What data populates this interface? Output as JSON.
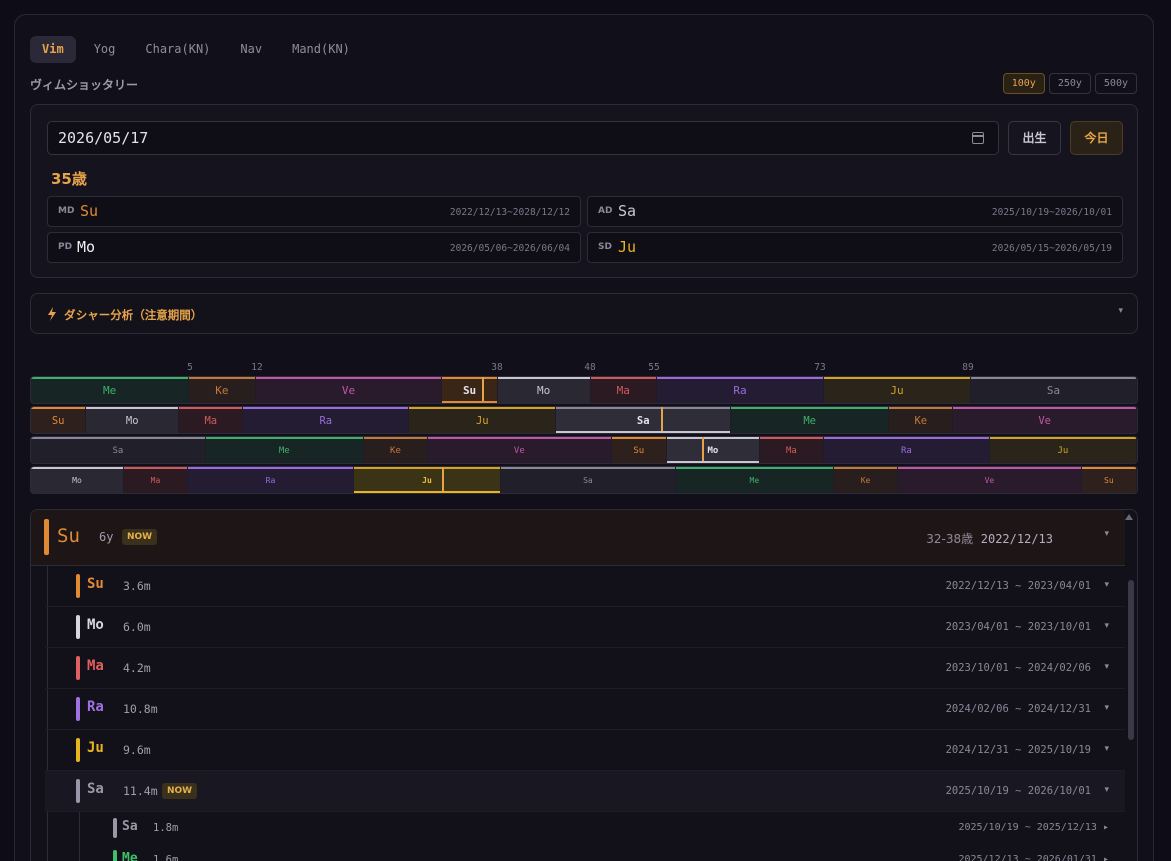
{
  "tabs": [
    "Vim",
    "Yog",
    "Chara(KN)",
    "Nav",
    "Mand(KN)"
  ],
  "subtitle": "ヴィムショッタリー",
  "ranges": [
    "100y",
    "250y",
    "500y"
  ],
  "date_value": "2026/05/17",
  "btn_birth": "出生",
  "btn_today": "今日",
  "age": "35歳",
  "current_dasas": [
    {
      "label": "MD",
      "planet": "Su",
      "range": "2022/12/13~2028/12/12",
      "color": "#e08a34"
    },
    {
      "label": "AD",
      "planet": "Sa",
      "range": "2025/10/19~2026/10/01",
      "color": "#c9c7d3"
    },
    {
      "label": "PD",
      "planet": "Mo",
      "range": "2026/05/06~2026/06/04",
      "color": "#f2f1f6"
    },
    {
      "label": "SD",
      "planet": "Ju",
      "range": "2026/05/15~2026/05/19",
      "color": "#e8b420"
    }
  ],
  "dashar_title": "ダシャー分析（注意期間）",
  "timeline_ticks": [
    "5",
    "12",
    "38",
    "48",
    "55",
    "73",
    "89"
  ],
  "timeline_rows": [
    [
      [
        "Me",
        14.3
      ],
      [
        "Ke",
        6.0
      ],
      [
        "Ve",
        16.9
      ],
      [
        "Su",
        5.0
      ],
      [
        "Mo",
        8.4
      ],
      [
        "Ma",
        6.0
      ],
      [
        "Ra",
        15.1
      ],
      [
        "Ju",
        13.3
      ],
      [
        "Sa",
        15.0
      ]
    ],
    [
      [
        "Su",
        5.0
      ],
      [
        "Mo",
        8.4
      ],
      [
        "Ma",
        5.8
      ],
      [
        "Ra",
        15.0
      ],
      [
        "Ju",
        13.3
      ],
      [
        "Sa",
        15.8
      ],
      [
        "Me",
        14.3
      ],
      [
        "Ke",
        5.8
      ],
      [
        "Ve",
        16.6
      ]
    ],
    [
      [
        "Sa",
        15.8
      ],
      [
        "Me",
        14.3
      ],
      [
        "Ke",
        5.8
      ],
      [
        "Ve",
        16.6
      ],
      [
        "Su",
        5.0
      ],
      [
        "Mo",
        8.4
      ],
      [
        "Ma",
        5.8
      ],
      [
        "Ra",
        15.0
      ],
      [
        "Ju",
        13.3
      ]
    ],
    [
      [
        "Mo",
        8.4
      ],
      [
        "Ma",
        5.8
      ],
      [
        "Ra",
        15.0
      ],
      [
        "Ju",
        13.3
      ],
      [
        "Sa",
        15.8
      ],
      [
        "Me",
        14.3
      ],
      [
        "Ke",
        5.8
      ],
      [
        "Ve",
        16.6
      ],
      [
        "Su",
        5.0
      ]
    ]
  ],
  "maha": {
    "planet": "Su",
    "duration": "6y",
    "badge": "NOW",
    "ages": "32-38歳",
    "start": "2022/12/13"
  },
  "antar": [
    {
      "planet": "Su",
      "duration": "3.6m",
      "start": "2022/12/13",
      "end": "2023/04/01",
      "color": "#e08a34"
    },
    {
      "planet": "Mo",
      "duration": "6.0m",
      "start": "2023/04/01",
      "end": "2023/10/01",
      "color": "#d8d6df"
    },
    {
      "planet": "Ma",
      "duration": "4.2m",
      "start": "2023/10/01",
      "end": "2024/02/06",
      "color": "#e06060"
    },
    {
      "planet": "Ra",
      "duration": "10.8m",
      "start": "2024/02/06",
      "end": "2024/12/31",
      "color": "#a071e0"
    },
    {
      "planet": "Ju",
      "duration": "9.6m",
      "start": "2024/12/31",
      "end": "2025/10/19",
      "color": "#e8b420"
    },
    {
      "planet": "Sa",
      "duration": "11.4m",
      "start": "2025/10/19",
      "end": "2026/10/01",
      "color": "#9a98a8",
      "badge": "NOW"
    }
  ],
  "pratyantar": [
    {
      "planet": "Sa",
      "duration": "1.8m",
      "start": "2025/10/19",
      "end": "2025/12/13",
      "color": "#9a98a8"
    },
    {
      "planet": "Me",
      "duration": "1.6m",
      "start": "2025/12/13",
      "end": "2026/01/31",
      "color": "#3fbf6a"
    }
  ],
  "planet_colors": {
    "Su": "#e08a34",
    "Mo": "#c8c6d0",
    "Ma": "#d05a5a",
    "Ra": "#9b6cdb",
    "Ju": "#d4a422",
    "Sa": "#8a8898",
    "Me": "#3fb06a",
    "Ke": "#c07a3a",
    "Ve": "#c058a8"
  }
}
